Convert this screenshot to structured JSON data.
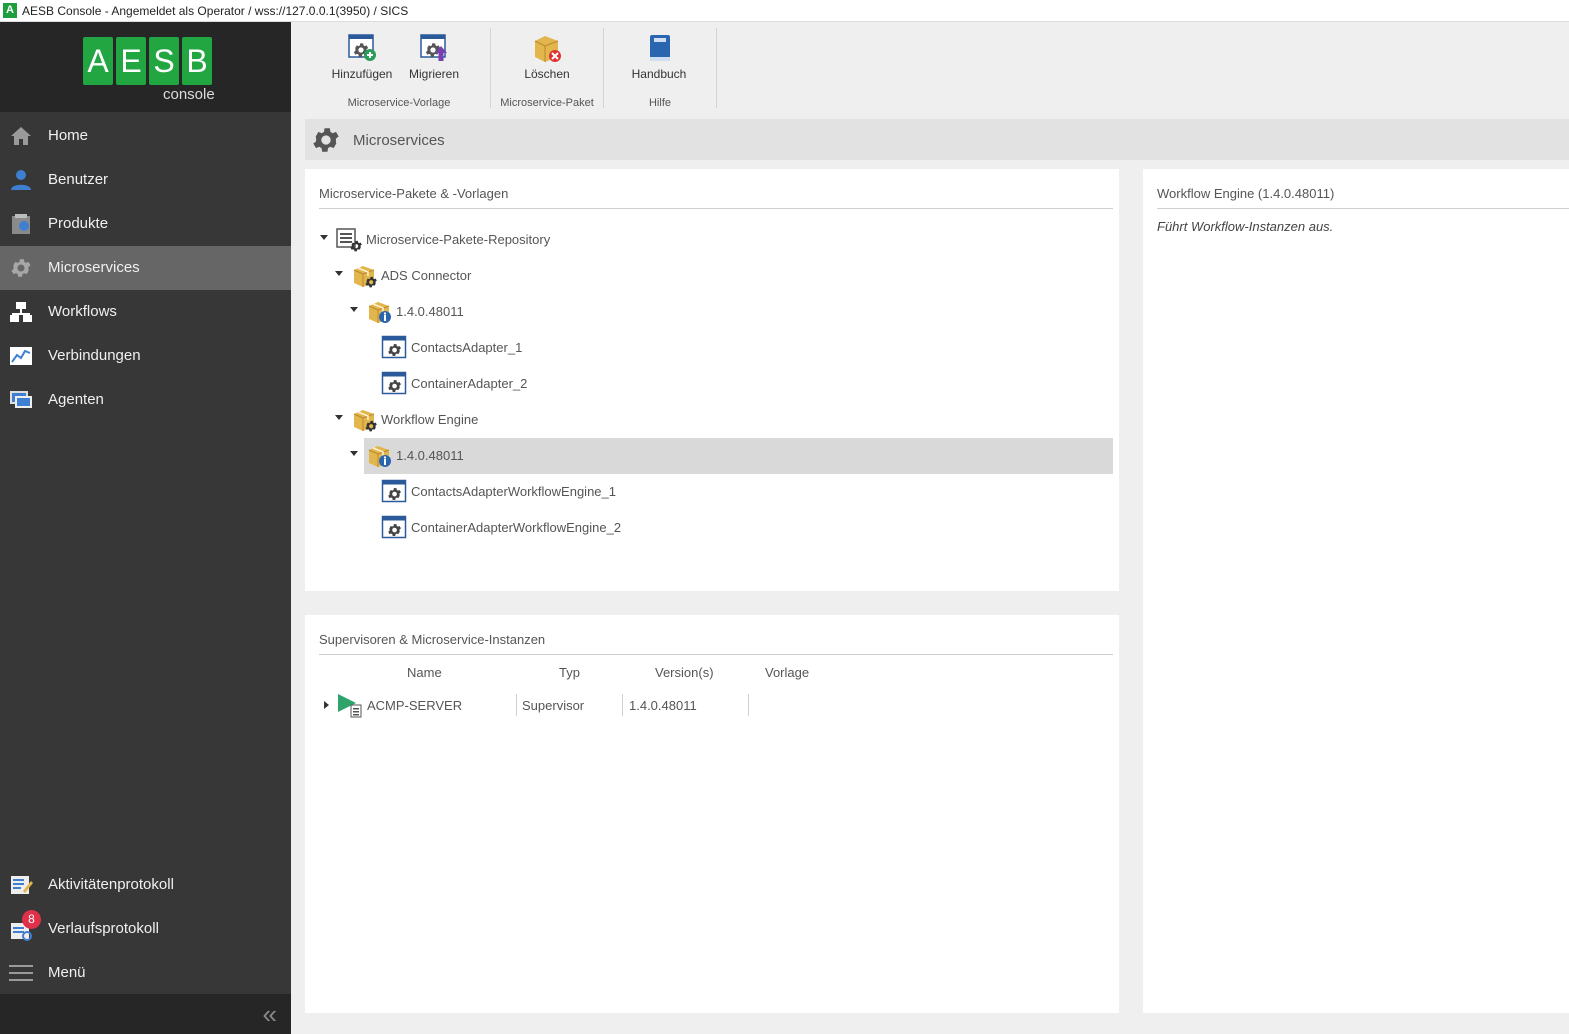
{
  "window": {
    "title": "AESB Console - Angemeldet als Operator / wss://127.0.0.1(3950) / SICS",
    "app_icon_letter": "A"
  },
  "logo": {
    "letters": [
      "A",
      "E",
      "S",
      "B"
    ],
    "subtitle": "console"
  },
  "sidebar": {
    "items": [
      {
        "label": "Home",
        "icon": "home-icon"
      },
      {
        "label": "Benutzer",
        "icon": "user-icon"
      },
      {
        "label": "Produkte",
        "icon": "products-icon"
      },
      {
        "label": "Microservices",
        "icon": "gear-icon",
        "active": true
      },
      {
        "label": "Workflows",
        "icon": "workflow-icon"
      },
      {
        "label": "Verbindungen",
        "icon": "chart-icon"
      },
      {
        "label": "Agenten",
        "icon": "monitor-icon"
      }
    ],
    "bottom_items": [
      {
        "label": "Aktivitätenprotokoll",
        "icon": "activity-log-icon"
      },
      {
        "label": "Verlaufsprotokoll",
        "icon": "history-log-icon",
        "badge": "8"
      },
      {
        "label": "Menü",
        "icon": "hamburger-icon"
      }
    ],
    "collapse_glyph": "«"
  },
  "ribbon": {
    "buttons": [
      {
        "label": "Hinzufügen",
        "icon": "add-template-icon"
      },
      {
        "label": "Migrieren",
        "icon": "migrate-icon"
      },
      {
        "label": "Löschen",
        "icon": "delete-package-icon"
      },
      {
        "label": "Handbuch",
        "icon": "manual-book-icon"
      }
    ],
    "groups": [
      "Microservice-Vorlage",
      "Microservice-Paket",
      "Hilfe"
    ]
  },
  "header": {
    "title": "Microservices",
    "icon": "gear-icon"
  },
  "packages_panel": {
    "title": "Microservice-Pakete & -Vorlagen",
    "tree": [
      {
        "label": "Microservice-Pakete-Repository",
        "type": "repository"
      },
      {
        "label": "ADS Connector",
        "type": "package"
      },
      {
        "label": "1.4.0.48011",
        "type": "version"
      },
      {
        "label": "ContactsAdapter_1",
        "type": "template"
      },
      {
        "label": "ContainerAdapter_2",
        "type": "template"
      },
      {
        "label": "Workflow Engine",
        "type": "package"
      },
      {
        "label": "1.4.0.48011",
        "type": "version",
        "selected": true
      },
      {
        "label": "ContactsAdapterWorkflowEngine_1",
        "type": "template"
      },
      {
        "label": "ContainerAdapterWorkflowEngine_2",
        "type": "template"
      }
    ]
  },
  "supervisors_panel": {
    "title": "Supervisoren & Microservice-Instanzen",
    "columns": [
      "Name",
      "Typ",
      "Version(s)",
      "Vorlage"
    ],
    "rows": [
      {
        "name": "ACMP-SERVER",
        "type": "Supervisor",
        "versions": "1.4.0.48011",
        "template": ""
      }
    ]
  },
  "detail_panel": {
    "title": "Workflow Engine (1.4.0.48011)",
    "description": "Führt Workflow-Instanzen aus."
  },
  "colors": {
    "accent_green": "#21a642",
    "sidebar_bg": "#373737",
    "sidebar_active": "#666666",
    "package_gold": "#e3b54d"
  }
}
